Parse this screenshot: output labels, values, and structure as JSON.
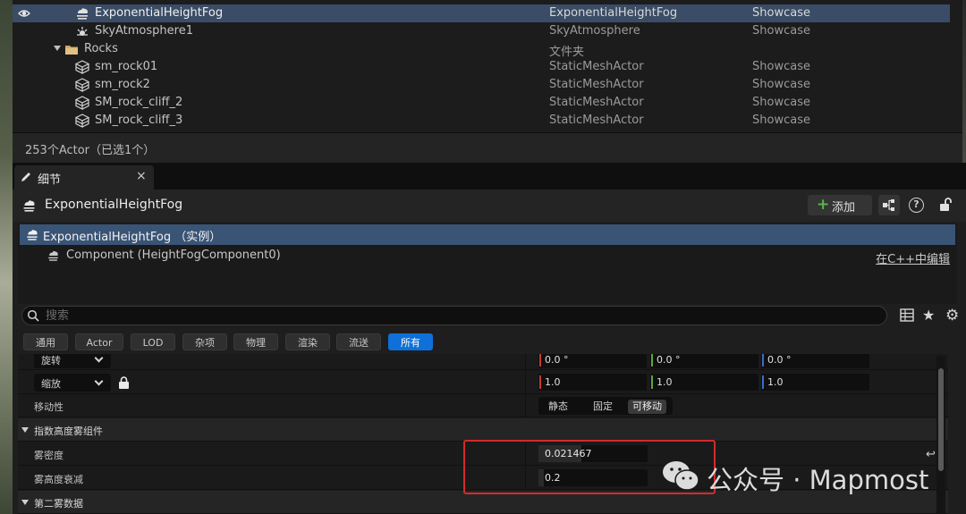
{
  "outliner": {
    "rows": [
      {
        "name": "ExponentialHeightFog",
        "type": "ExponentialHeightFog",
        "level": "Showcase",
        "icon": "fog-icon",
        "selected": true
      },
      {
        "name": "SkyAtmosphere1",
        "type": "SkyAtmosphere",
        "level": "Showcase",
        "icon": "sky-atmosphere-icon"
      },
      {
        "name": "Rocks",
        "type": "文件夹",
        "level": "",
        "icon": "folder-icon"
      },
      {
        "name": "sm_rock01",
        "type": "StaticMeshActor",
        "level": "Showcase",
        "icon": "static-mesh-icon"
      },
      {
        "name": "sm_rock2",
        "type": "StaticMeshActor",
        "level": "Showcase",
        "icon": "static-mesh-icon"
      },
      {
        "name": "SM_rock_cliff_2",
        "type": "StaticMeshActor",
        "level": "Showcase",
        "icon": "static-mesh-icon"
      },
      {
        "name": "SM_rock_cliff_3",
        "type": "StaticMeshActor",
        "level": "Showcase",
        "icon": "static-mesh-icon"
      }
    ],
    "footer": "253个Actor（已选1个）"
  },
  "details_tab": {
    "label": "细节",
    "close": "×"
  },
  "details": {
    "actor_title": "ExponentialHeightFog",
    "add_label": "添加",
    "help": "?",
    "components": {
      "selected": "ExponentialHeightFog （实例）",
      "child": "Component (HeightFogComponent0)",
      "edit_link": "在C++中编辑"
    },
    "search": {
      "placeholder": "搜索"
    },
    "filters": [
      "通用",
      "Actor",
      "LOD",
      "杂项",
      "物理",
      "渲染",
      "流送",
      "所有"
    ],
    "active_filter": "所有",
    "properties": {
      "rotation": {
        "mode": "旋转",
        "values": [
          "0.0 °",
          "0.0 °",
          "0.0 °"
        ]
      },
      "scale": {
        "mode": "缩放",
        "values": [
          "1.0",
          "1.0",
          "1.0"
        ]
      },
      "mobility": {
        "label": "移动性",
        "options": [
          "静态",
          "固定",
          "可移动"
        ],
        "selected": "可移动"
      },
      "section_fog": "指数高度雾组件",
      "fog_density": {
        "label": "雾密度",
        "value": "0.021467"
      },
      "fog_falloff": {
        "label": "雾高度衰减",
        "value": "0.2"
      },
      "section_second": "第二雾数据"
    }
  },
  "watermark": {
    "text": "公众号 · Mapmost"
  },
  "colors": {
    "selection": "#3a4c66",
    "active_filter": "#0e70d8",
    "highlight": "#d52a2a",
    "axis_x": "#c83a2e",
    "axis_y": "#5ba83a",
    "axis_z": "#3a6ec8"
  }
}
